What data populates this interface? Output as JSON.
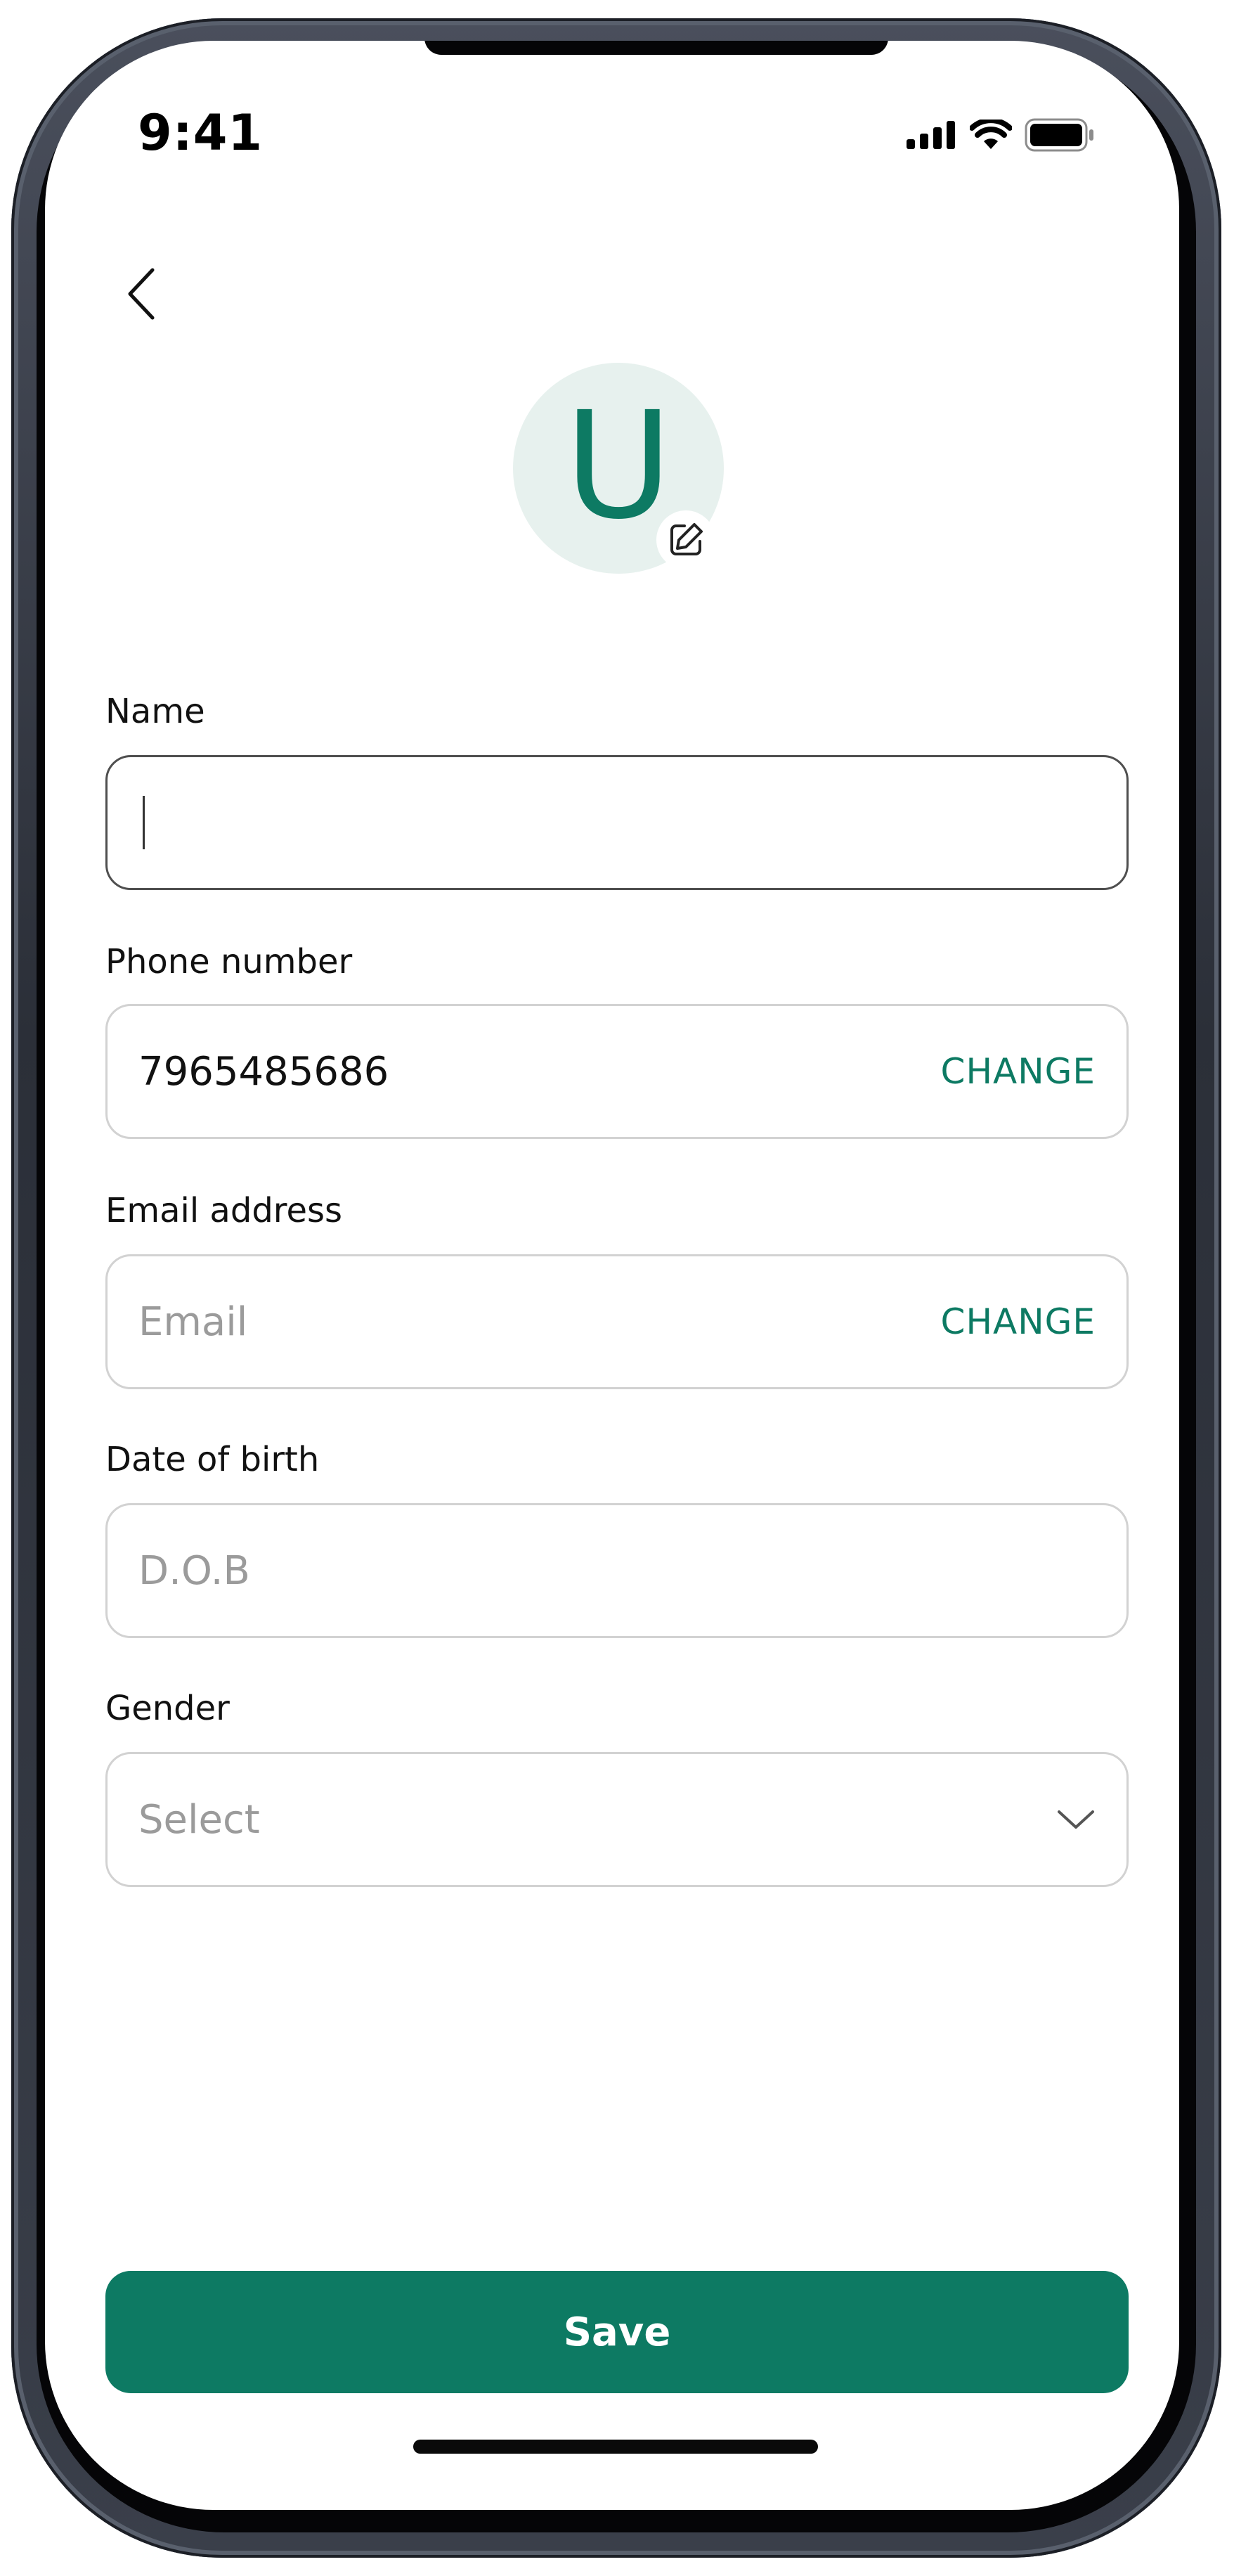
{
  "status_bar": {
    "time": "9:41",
    "icons": [
      "cellular-signal-icon",
      "wifi-icon",
      "battery-icon"
    ]
  },
  "header": {
    "back_icon": "chevron-left-icon"
  },
  "avatar": {
    "initial": "U",
    "edit_icon": "edit-icon",
    "bg_color": "#e7f1ee",
    "text_color": "#0d7a63"
  },
  "form": {
    "name": {
      "label": "Name",
      "value": ""
    },
    "phone": {
      "label": "Phone number",
      "value": "7965485686",
      "action": "CHANGE"
    },
    "email": {
      "label": "Email address",
      "placeholder": "Email",
      "action": "CHANGE"
    },
    "dob": {
      "label": "Date of birth",
      "placeholder": "D.O.B"
    },
    "gender": {
      "label": "Gender",
      "placeholder": "Select",
      "icon": "chevron-down-icon"
    }
  },
  "save_label": "Save",
  "colors": {
    "accent": "#0d7a63",
    "border": "#d2d2d2",
    "placeholder": "#9b9b9b"
  }
}
